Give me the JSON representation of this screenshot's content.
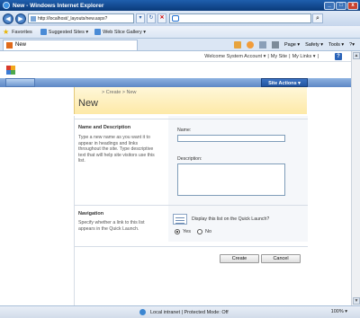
{
  "window": {
    "title": "New - Windows Internet Explorer",
    "minimize": "_",
    "maximize": "□",
    "close": "x"
  },
  "address_bar": {
    "back": "◀",
    "forward": "▶",
    "url": "http://localhost/_layouts/new.aspx?",
    "go": "▾",
    "refresh": "↻",
    "stop": "✕"
  },
  "search": {
    "value": "",
    "go": "⌕"
  },
  "favorites_bar": {
    "favorites_label": "Favorites",
    "links": [
      "Suggested Sites ▾",
      "Web Slice Gallery ▾"
    ]
  },
  "tab": {
    "label": "New"
  },
  "command_bar": {
    "page": "Page ▾",
    "safety": "Safety ▾",
    "tools": "Tools ▾",
    "help": "?▾"
  },
  "sharepoint": {
    "welcome": "Welcome System Account ▾",
    "sep1": "|",
    "my_site": "My Site",
    "sep2": "|",
    "my_links": "My Links ▾",
    "sep3": "|",
    "help": "?",
    "site_actions": "Site Actions ▾",
    "breadcrumb": "> Create > New",
    "page_title": "New",
    "name_section": {
      "heading": "Name and Description",
      "description": "Type a new name as you want it to appear in headings and links throughout the site. Type descriptive text that will help site visitors use this list.",
      "name_label": "Name:",
      "name_value": "",
      "description_label": "Description:",
      "description_value": ""
    },
    "nav_section": {
      "heading": "Navigation",
      "description": "Specify whether a link to this list appears in the Quick Launch.",
      "question": "Display this list on the Quick Launch?",
      "yes_label": "Yes",
      "no_label": "No",
      "selected": "Yes"
    },
    "buttons": {
      "create": "Create",
      "cancel": "Cancel"
    }
  },
  "status_bar": {
    "zone": "Local intranet | Protected Mode: Off",
    "zoom": "100% ▾"
  },
  "colors": {
    "title_bar": "#1f5fae",
    "site_actions": "#2a5fab",
    "title_area": "#fde9a7"
  }
}
